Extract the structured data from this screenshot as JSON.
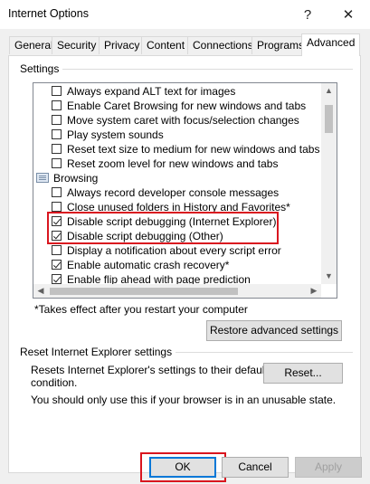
{
  "window": {
    "title": "Internet Options",
    "help_glyph": "?",
    "close_glyph": "✕"
  },
  "tabs": [
    {
      "label": "General"
    },
    {
      "label": "Security"
    },
    {
      "label": "Privacy"
    },
    {
      "label": "Content"
    },
    {
      "label": "Connections"
    },
    {
      "label": "Programs"
    },
    {
      "label": "Advanced",
      "active": true
    }
  ],
  "settings": {
    "group_label": "Settings",
    "items": [
      {
        "type": "checkbox",
        "label": "Always expand ALT text for images",
        "checked": false
      },
      {
        "type": "checkbox",
        "label": "Enable Caret Browsing for new windows and tabs",
        "checked": false
      },
      {
        "type": "checkbox",
        "label": "Move system caret with focus/selection changes",
        "checked": false
      },
      {
        "type": "checkbox",
        "label": "Play system sounds",
        "checked": false
      },
      {
        "type": "checkbox",
        "label": "Reset text size to medium for new windows and tabs",
        "checked": false
      },
      {
        "type": "checkbox",
        "label": "Reset zoom level for new windows and tabs",
        "checked": false
      },
      {
        "type": "category",
        "label": "Browsing"
      },
      {
        "type": "checkbox",
        "label": "Always record developer console messages",
        "checked": false
      },
      {
        "type": "checkbox",
        "label": "Close unused folders in History and Favorites*",
        "checked": false
      },
      {
        "type": "checkbox",
        "label": "Disable script debugging (Internet Explorer)",
        "checked": true
      },
      {
        "type": "checkbox",
        "label": "Disable script debugging (Other)",
        "checked": true
      },
      {
        "type": "checkbox",
        "label": "Display a notification about every script error",
        "checked": false
      },
      {
        "type": "checkbox",
        "label": "Enable automatic crash recovery*",
        "checked": true
      },
      {
        "type": "checkbox",
        "label": "Enable flip ahead with page prediction",
        "checked": true
      }
    ],
    "scroll_up": "▲",
    "scroll_down": "▼",
    "scroll_left": "◀",
    "scroll_right": "▶"
  },
  "note": "*Takes effect after you restart your computer",
  "restore_button": "Restore advanced settings",
  "reset_group": {
    "label": "Reset Internet Explorer settings",
    "description_line1": "Resets Internet Explorer's settings to their default",
    "description_line2": "condition.",
    "reset_button": "Reset...",
    "warning": "You should only use this if your browser is in an unusable state."
  },
  "footer": {
    "ok": "OK",
    "cancel": "Cancel",
    "apply": "Apply"
  },
  "colors": {
    "highlight_box": "#d9161f",
    "focus_border": "#0078d7"
  }
}
